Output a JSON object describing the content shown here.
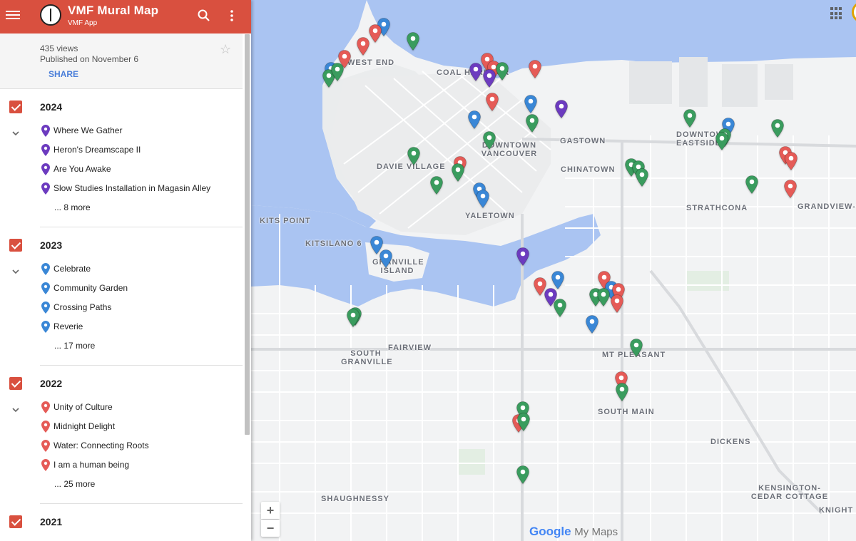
{
  "header": {
    "title": "VMF Mural Map",
    "subtitle": "VMF App"
  },
  "info": {
    "views": "435 views",
    "published": "Published on November 6",
    "share_label": "SHARE"
  },
  "colors": {
    "header_bg": "#d9503f",
    "pin_purple": "#6c3bbf",
    "pin_blue": "#3a87d6",
    "pin_red": "#e55b57",
    "pin_green": "#3a9c5e"
  },
  "layers": [
    {
      "name": "2024",
      "color": "#6c3bbf",
      "items": [
        "Where We Gather",
        "Heron's Dreamscape II",
        "Are You Awake",
        "Slow Studies Installation in Magasin Alley"
      ],
      "more": "... 8 more"
    },
    {
      "name": "2023",
      "color": "#3a87d6",
      "items": [
        "Celebrate",
        "Community Garden",
        "Crossing Paths",
        "Reverie"
      ],
      "more": "... 17 more"
    },
    {
      "name": "2022",
      "color": "#e55b57",
      "items": [
        "Unity of Culture",
        "Midnight Delight",
        "Water: Connecting Roots",
        "I am a human being"
      ],
      "more": "... 25 more"
    },
    {
      "name": "2021",
      "color": "#3a9c5e",
      "items": [],
      "more": ""
    }
  ],
  "map": {
    "labels": [
      "WEST END",
      "COAL HARBOUR",
      "GASTOWN",
      "DOWNTOWN VANCOUVER",
      "DOWNTOWN EASTSIDE",
      "DAVIE VILLAGE",
      "CHINATOWN",
      "STRATHCONA",
      "GRANDVIEW-WO",
      "YALETOWN",
      "KITS POINT",
      "KITSILANO 6",
      "GRANVILLE ISLAND",
      "FAIRVIEW",
      "SOUTH GRANVILLE",
      "MT PLEASANT",
      "SOUTH MAIN",
      "DICKENS",
      "SHAUGHNESSY",
      "KENSINGTON-CEDAR COTTAGE",
      "KNIGHT"
    ],
    "zoom_in": "+",
    "zoom_out": "−",
    "brand_google": "Google",
    "brand_mymaps": "My Maps"
  }
}
